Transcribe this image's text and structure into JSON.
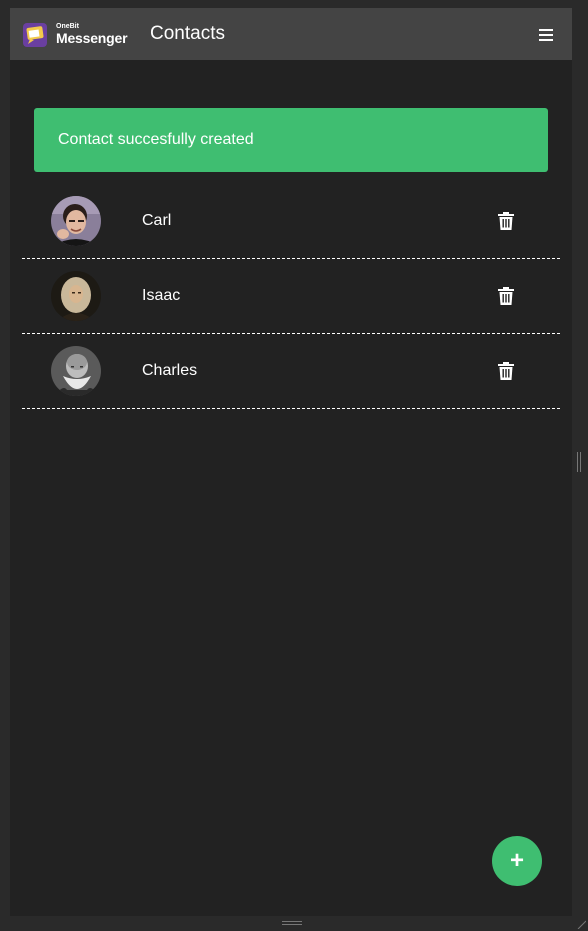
{
  "header": {
    "logo_small": "OneBit",
    "logo_big": "Messenger",
    "title": "Contacts"
  },
  "alert": {
    "message": "Contact succesfully created",
    "color": "#3fbe71"
  },
  "contacts": [
    {
      "name": "Carl",
      "avatar_icon": "avatar-photo-icon",
      "delete_icon": "trash-icon"
    },
    {
      "name": "Isaac",
      "avatar_icon": "avatar-photo-icon",
      "delete_icon": "trash-icon"
    },
    {
      "name": "Charles",
      "avatar_icon": "avatar-photo-icon",
      "delete_icon": "trash-icon"
    }
  ],
  "fab": {
    "label": "+",
    "icon": "plus-icon"
  },
  "colors": {
    "accent": "#3fbe71",
    "navbar": "#444444",
    "background": "#222222"
  }
}
